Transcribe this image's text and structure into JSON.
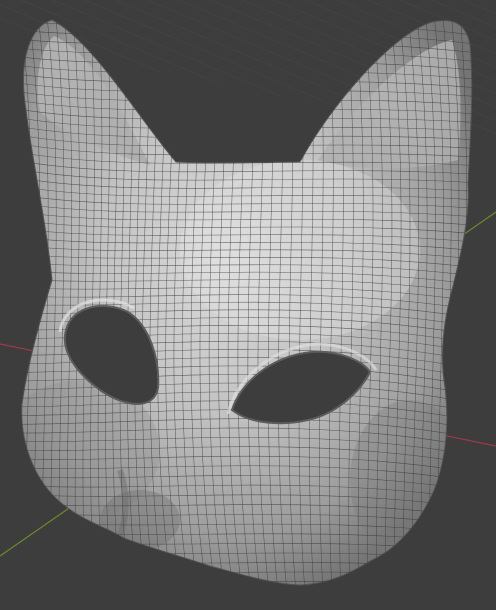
{
  "viewport": {
    "background_color": "#3d3d3d",
    "grid_line_color": "#474747",
    "x_axis_color": "#9a3a4a",
    "y_axis_color": "#6a8a2a",
    "show_grid": true,
    "show_axes": true
  },
  "model": {
    "name_hint": "cat-mask",
    "base_color": "#b9b9b9",
    "highlight_color": "#d6d6d6",
    "shadow_color": "#6e6e6e",
    "wire_color": "#3a3a3a",
    "eye_hole_color": "#3d3d3d",
    "wireframe_visible": true
  }
}
